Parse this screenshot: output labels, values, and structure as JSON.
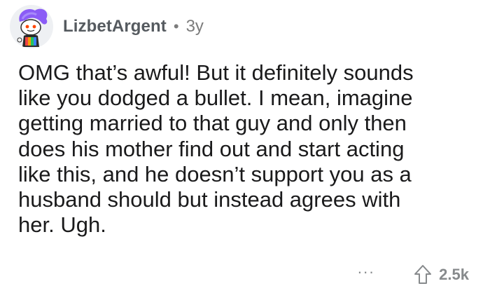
{
  "comment": {
    "author": "LizbetArgent",
    "separator": "•",
    "age": "3y",
    "avatar_icon": "snoo-avatar-purple-hair",
    "body": "OMG that’s awful! But it definitely sounds\nlike you dodged a bullet. I mean, imagine\ngetting married to that guy and only then\ndoes his mother find out and start acting\nlike this, and he doesn’t support you as a\nhusband should but instead agrees with\nher. Ugh.",
    "more_label": "···",
    "upvote_icon": "upvote-arrow-icon",
    "score": "2.5k"
  },
  "colors": {
    "text": "#1a1a1b",
    "username": "#555a5f",
    "meta": "#7c7c7c",
    "action": "#878a8c",
    "avatar_hair": "#8b5cf6"
  }
}
